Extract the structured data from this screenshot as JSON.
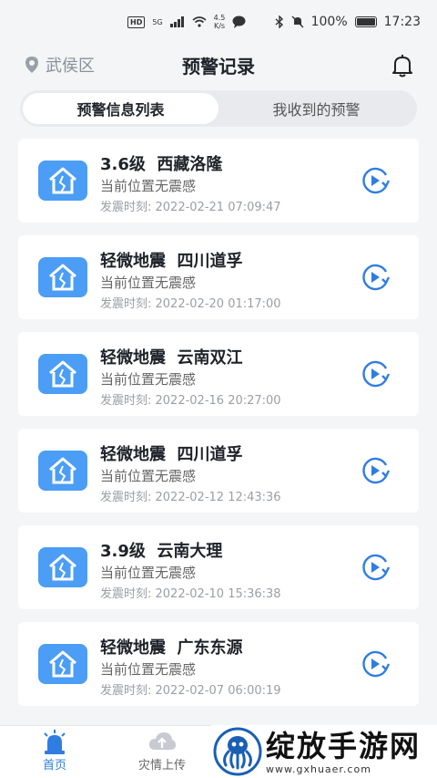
{
  "status_bar": {
    "hd": "HD",
    "net": "5G",
    "speed": "4.5",
    "speed_unit": "K/s",
    "battery": "100%",
    "time": "17:23"
  },
  "header": {
    "location": "武侯区",
    "title": "预警记录"
  },
  "tabs": [
    {
      "label": "预警信息列表",
      "active": true
    },
    {
      "label": "我收到的预警",
      "active": false
    }
  ],
  "records": [
    {
      "title": "3.6级  西藏洛隆",
      "status": "当前位置无震感",
      "time": "发震时刻:  2022-02-21 07:09:47"
    },
    {
      "title": "轻微地震  四川道孚",
      "status": "当前位置无震感",
      "time": "发震时刻:  2022-02-20 01:17:00"
    },
    {
      "title": "轻微地震  云南双江",
      "status": "当前位置无震感",
      "time": "发震时刻:  2022-02-16 20:27:00"
    },
    {
      "title": "轻微地震  四川道孚",
      "status": "当前位置无震感",
      "time": "发震时刻:  2022-02-12 12:43:36"
    },
    {
      "title": "3.9级  云南大理",
      "status": "当前位置无震感",
      "time": "发震时刻:  2022-02-10 15:36:38"
    },
    {
      "title": "轻微地震  广东东源",
      "status": "当前位置无震感",
      "time": "发震时刻:  2022-02-07 06:00:19"
    }
  ],
  "bottom_nav": {
    "home": "首页",
    "upload": "灾情上传"
  },
  "watermark": {
    "main": "绽放手游网",
    "sub": "www.gxhuaer.com"
  },
  "colors": {
    "accent": "#4b9df5",
    "nav_active": "#2f7de1"
  }
}
